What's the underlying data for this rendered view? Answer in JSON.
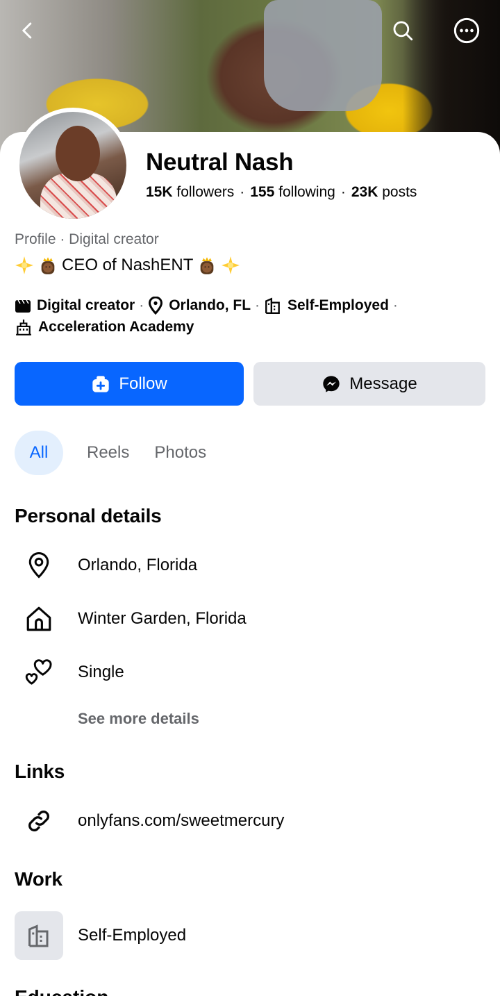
{
  "profile": {
    "name": "Neutral Nash",
    "followers_count": "15K",
    "followers_label": "followers",
    "following_count": "155",
    "following_label": "following",
    "posts_count": "23K",
    "posts_label": "posts",
    "category": "Profile · Digital creator",
    "bio": "CEO of NashENT",
    "meta": {
      "creator": "Digital creator",
      "location": "Orlando, FL",
      "work": "Self-Employed",
      "school": "Acceleration Academy"
    }
  },
  "actions": {
    "follow_label": "Follow",
    "message_label": "Message"
  },
  "tabs": [
    {
      "label": "All",
      "active": true
    },
    {
      "label": "Reels",
      "active": false
    },
    {
      "label": "Photos",
      "active": false
    }
  ],
  "personal_details": {
    "title": "Personal details",
    "items": [
      {
        "icon": "location-pin-icon",
        "text": "Orlando, Florida"
      },
      {
        "icon": "home-icon",
        "text": "Winter Garden, Florida"
      },
      {
        "icon": "hearts-icon",
        "text": "Single"
      }
    ],
    "see_more": "See more details"
  },
  "links": {
    "title": "Links",
    "items": [
      {
        "icon": "link-icon",
        "text": "onlyfans.com/sweetmercury"
      }
    ]
  },
  "work": {
    "title": "Work",
    "items": [
      {
        "icon": "building-icon",
        "text": "Self-Employed"
      }
    ]
  },
  "education": {
    "title": "Education"
  },
  "colors": {
    "primary_blue": "#0866ff",
    "secondary_gray": "#e4e6eb",
    "text_secondary": "#65676b",
    "tab_active_bg": "#e3effd"
  }
}
